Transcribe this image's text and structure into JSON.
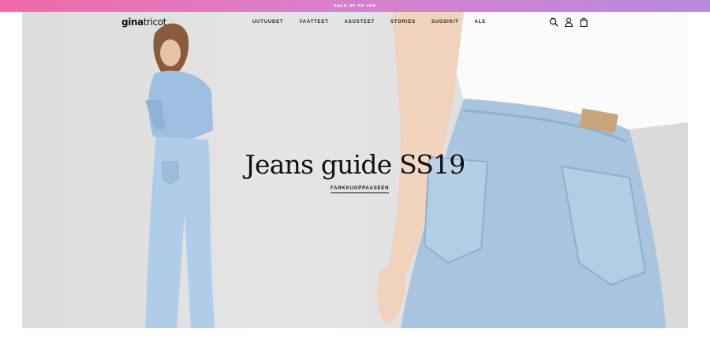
{
  "promo": {
    "text": "SALE UP TO 75%"
  },
  "header": {
    "logo_bold": "gina",
    "logo_light": "tricot",
    "nav": [
      "UUTUUDET",
      "VAATTEET",
      "ASUSTEET",
      "STORIES",
      "SUOSIKIT",
      "ALE"
    ],
    "icons": [
      "search-icon",
      "account-icon",
      "bag-icon"
    ]
  },
  "hero": {
    "title": "Jeans guide SS19",
    "cta": "FARKKUOPPAASEEN"
  },
  "colors": {
    "promo_start": "#f06aa8",
    "promo_end": "#b68bdc",
    "denim": "#a9c4df",
    "text": "#111111"
  }
}
